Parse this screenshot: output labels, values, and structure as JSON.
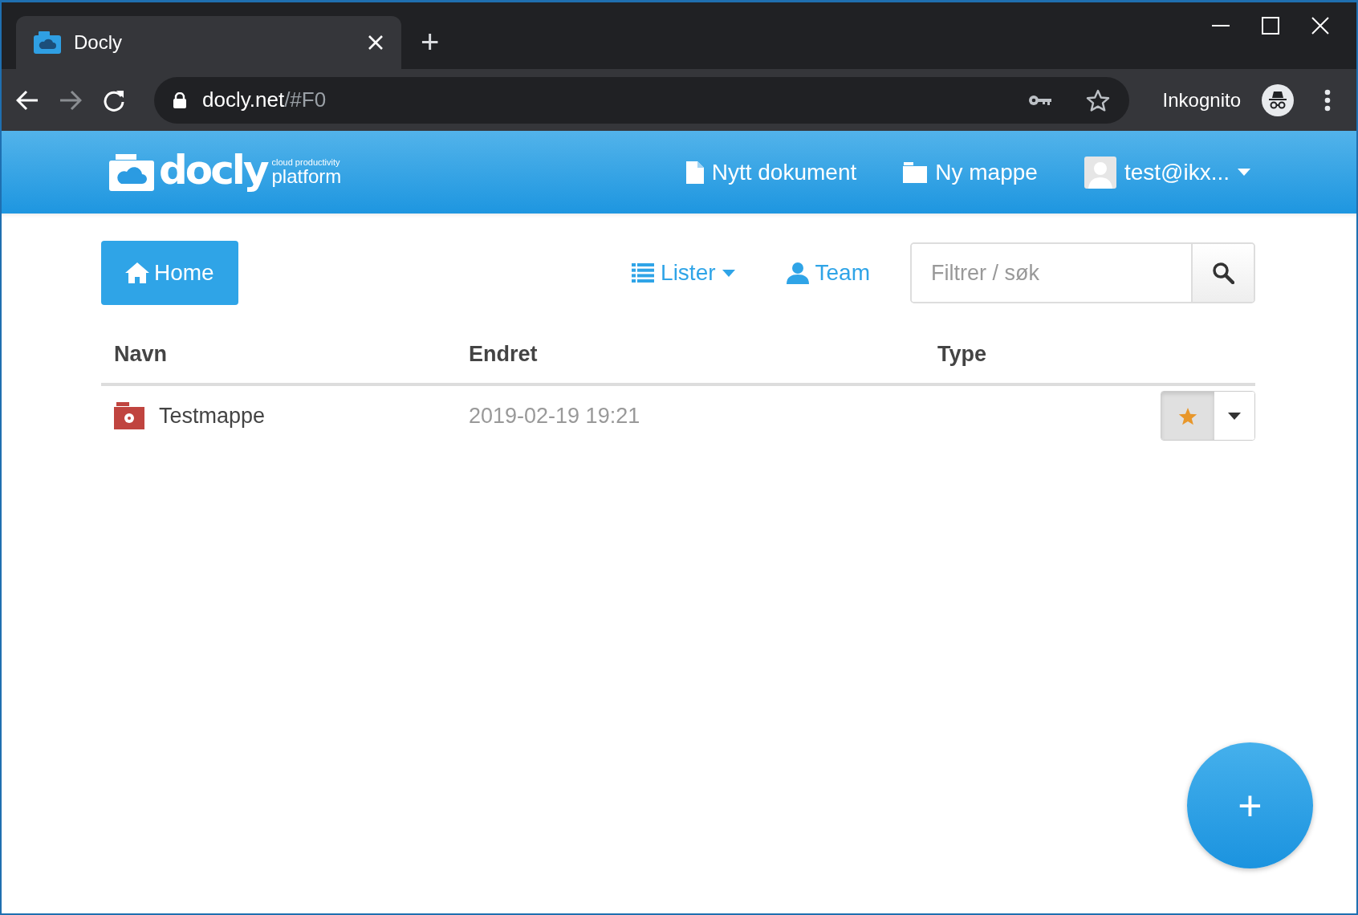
{
  "browser": {
    "tab": {
      "title": "Docly",
      "selected": true
    },
    "new_tab": "+",
    "url": {
      "host": "docly.net",
      "path": "/#F0"
    },
    "profile": "Inkognito"
  },
  "app_header": {
    "logo": {
      "word": "docly",
      "tagline": "cloud productivity",
      "subtitle": "platform"
    },
    "nav": [
      {
        "kind": "document",
        "label": "Nytt dokument"
      },
      {
        "kind": "folder",
        "label": "Ny mappe"
      },
      {
        "kind": "user",
        "label": "test@ikx..."
      }
    ]
  },
  "toolbar": {
    "home": "Home",
    "lists": "Lister",
    "team": "Team",
    "search": {
      "placeholder": "Filtrer / søk"
    }
  },
  "table": {
    "columns": [
      "Navn",
      "Endret",
      "Type"
    ],
    "rows": [
      {
        "name": "Testmappe",
        "changed": "2019-02-19 19:21",
        "starred": true
      }
    ]
  },
  "fab": "+"
}
